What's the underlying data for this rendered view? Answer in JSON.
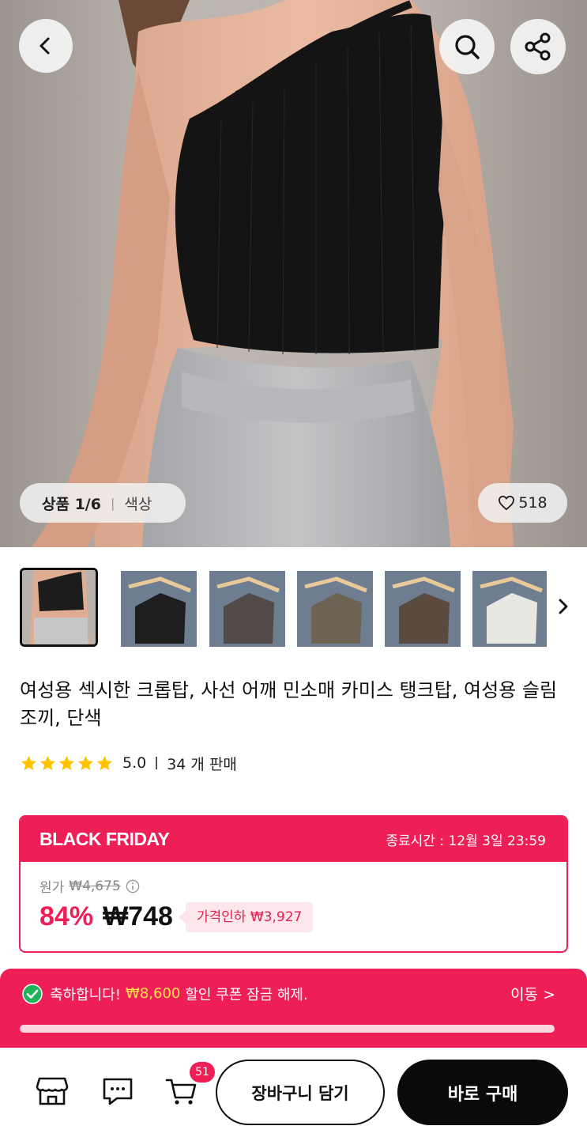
{
  "hero": {
    "counter_label": "상품 1/6",
    "category_label": "색상",
    "likes": "518"
  },
  "thumbnails": {
    "items": [
      {
        "color": "#1c1c1c",
        "selected": true
      },
      {
        "color": "#1e1e1e"
      },
      {
        "color": "#524a48"
      },
      {
        "color": "#6e6252"
      },
      {
        "color": "#5a4a40"
      },
      {
        "color": "#e9e7e2"
      }
    ]
  },
  "product": {
    "title": "여성용 섹시한 크롭탑, 사선 어깨 민소매 카미스 탱크탑, 여성용 슬림 조끼, 단색",
    "rating": "5.0",
    "stars": 5,
    "sold": "34 개 판매"
  },
  "deal": {
    "label": "BLACK FRIDAY",
    "ends": "종료시간 :  12월 3일 23:59",
    "original_label": "원가",
    "original_price": "₩4,675",
    "discount": "84%",
    "price": "₩748",
    "price_drop": "가격인하 ₩3,927"
  },
  "coupon": {
    "prefix": "축하합니다!",
    "amount": "₩8,600",
    "suffix": "할인 쿠폰 잠금 해제.",
    "go_label": "이동 >",
    "progress": 1.0
  },
  "bottom": {
    "cart_count": "51",
    "cart_button": "장바구니 담기",
    "buy_button": "바로 구매"
  },
  "colors": {
    "accent": "#ee1f57",
    "coupon_amount": "#ffe14d",
    "buy_button": "#0a0a0a"
  }
}
